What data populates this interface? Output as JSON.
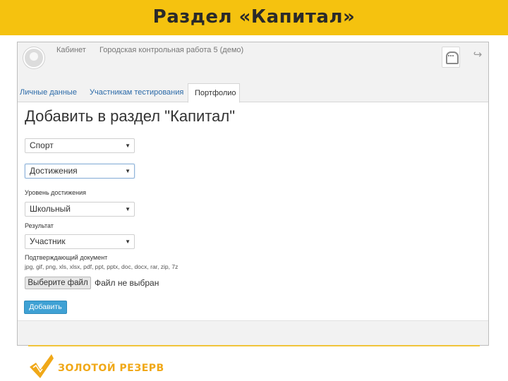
{
  "slide": {
    "title": "Раздел «Капитал»",
    "brand_name": "ЗОЛОТОЙ РЕЗЕРВ"
  },
  "topbar": {
    "nav": [
      "Кабинет",
      "Городская контрольная работа 5 (демо)"
    ]
  },
  "tabs": [
    {
      "label": "Личные данные",
      "active": false
    },
    {
      "label": "Участникам тестирования",
      "active": false
    },
    {
      "label": "Портфолио",
      "active": true
    }
  ],
  "form": {
    "title": "Добавить в раздел \"Капитал\"",
    "category_select": {
      "value": "Спорт"
    },
    "type_select": {
      "value": "Достижения"
    },
    "level_label": "Уровень достижения",
    "level_select": {
      "value": "Школьный"
    },
    "result_label": "Результат",
    "result_select": {
      "value": "Участник"
    },
    "document_label": "Подтверждающий документ",
    "file_types": "jpg, gif, png, xls, xlsx, pdf, ppt, pptx, doc, docx, rar, zip, 7z",
    "file_button": "Выберите файл",
    "file_status": "Файл не выбран",
    "submit_label": "Добавить"
  },
  "colors": {
    "header": "#f5c20f",
    "submit": "#3fa1d4",
    "brand": "#f0a818"
  }
}
